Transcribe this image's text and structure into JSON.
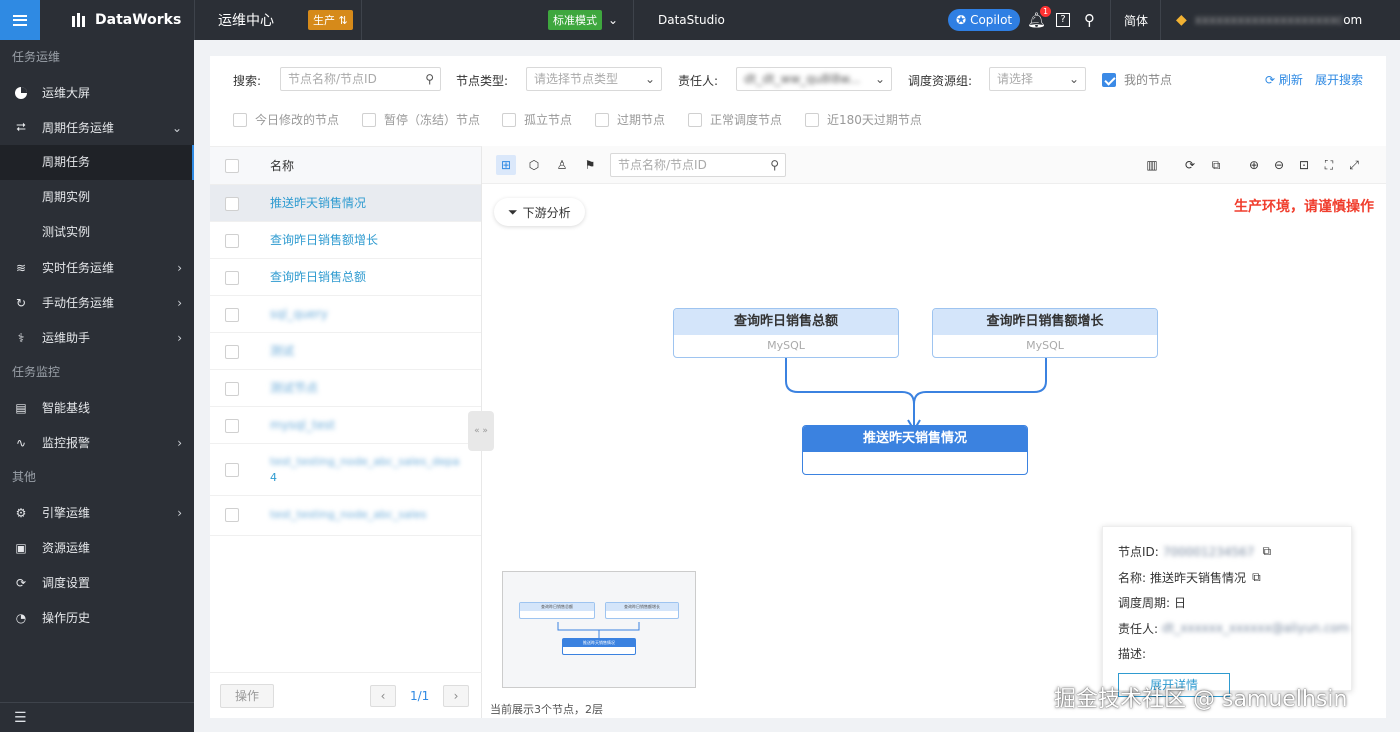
{
  "header": {
    "logo": "DataWorks",
    "module": "运维中心",
    "env_badge": "生产",
    "mode_badge": "标准模式",
    "datastudio": "DataStudio",
    "copilot": "Copilot",
    "notif_count": "1",
    "lang": "简体",
    "user_suffix": "om"
  },
  "sidebar": {
    "sections": [
      "任务运维",
      "任务监控",
      "其他"
    ],
    "items": [
      {
        "label": "运维大屏",
        "icon": "pie-chart-icon"
      },
      {
        "label": "周期任务运维",
        "icon": "cycle-icon"
      },
      {
        "label": "实时任务运维",
        "icon": "stream-icon"
      },
      {
        "label": "手动任务运维",
        "icon": "manual-icon"
      },
      {
        "label": "运维助手",
        "icon": "stethoscope-icon"
      },
      {
        "label": "智能基线",
        "icon": "baseline-icon"
      },
      {
        "label": "监控报警",
        "icon": "pulse-icon"
      },
      {
        "label": "引擎运维",
        "icon": "engine-icon"
      },
      {
        "label": "资源运维",
        "icon": "resource-icon"
      },
      {
        "label": "调度设置",
        "icon": "schedule-icon"
      },
      {
        "label": "操作历史",
        "icon": "history-icon"
      }
    ],
    "subitems": [
      "周期任务",
      "周期实例",
      "测试实例"
    ]
  },
  "filters": {
    "search_label": "搜索:",
    "search_placeholder": "节点名称/节点ID",
    "type_label": "节点类型:",
    "type_placeholder": "请选择节点类型",
    "owner_label": "责任人:",
    "owner_value": "dt_dt_ww_qu8l8w...",
    "group_label": "调度资源组:",
    "group_placeholder": "请选择",
    "my_nodes": "我的节点",
    "refresh": "刷新",
    "expand": "展开搜索",
    "checks": [
      "今日修改的节点",
      "暂停（冻结）节点",
      "孤立节点",
      "过期节点",
      "正常调度节点",
      "近180天过期节点"
    ]
  },
  "list": {
    "header": "名称",
    "rows": [
      "推送昨天销售情况",
      "查询昨日销售额增长",
      "查询昨日销售总额",
      "sql_query",
      "测试",
      "测试节点",
      "mysql_test",
      "test_testing_node_abc_sales_department_yy",
      "4",
      "test_testing_node_abc_sales"
    ],
    "action_btn": "操作",
    "page": "1/1"
  },
  "graph": {
    "search_placeholder": "节点名称/节点ID",
    "downstream": "下游分析",
    "warning": "生产环境，请谨慎操作",
    "nodes": [
      {
        "title": "查询昨日销售总额",
        "sub": "MySQL"
      },
      {
        "title": "查询昨日销售额增长",
        "sub": "MySQL"
      },
      {
        "title": "推送昨天销售情况",
        "sub": ""
      }
    ],
    "status": "当前展示3个节点，2层"
  },
  "info": {
    "id_label": "节点ID:",
    "id_value": "700001234567",
    "name_label": "名称:",
    "name_value": "推送昨天销售情况",
    "cycle_label": "调度周期:",
    "cycle_value": "日",
    "owner_label": "责任人:",
    "owner_value": "dt_xxxxxx_xxxxxx@aliyun.com",
    "desc_label": "描述:",
    "detail_btn": "展开详情"
  },
  "watermark": "掘金技术社区 @ samuelhsin"
}
